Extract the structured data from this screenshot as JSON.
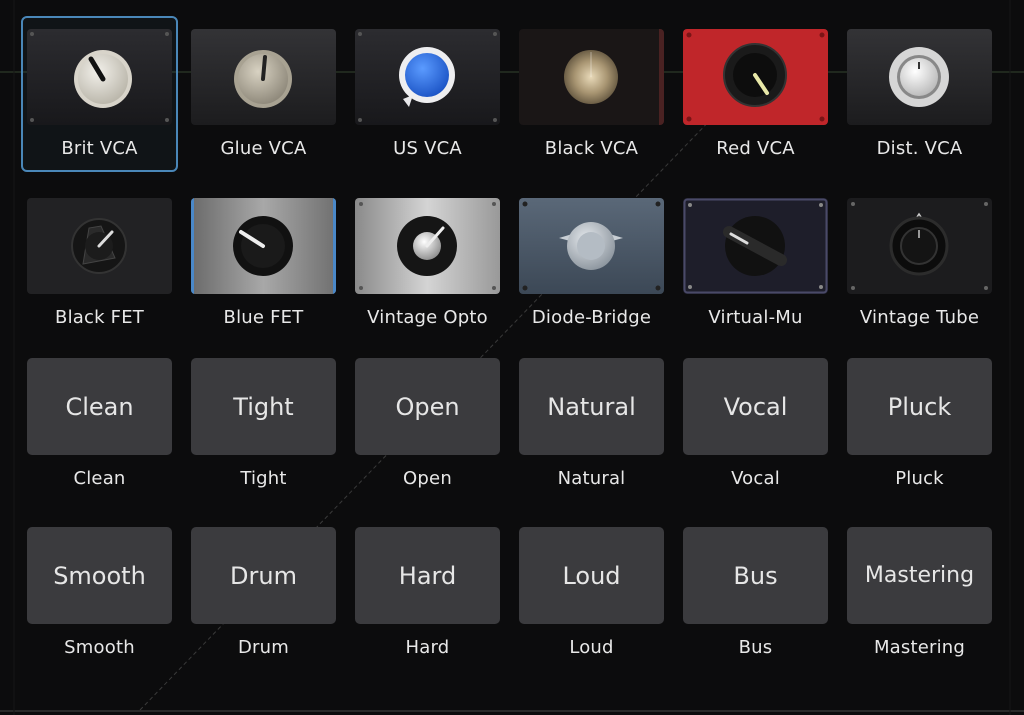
{
  "models": [
    {
      "label": "Brit VCA"
    },
    {
      "label": "Glue VCA"
    },
    {
      "label": "US VCA"
    },
    {
      "label": "Black VCA"
    },
    {
      "label": "Red VCA"
    },
    {
      "label": "Dist. VCA"
    },
    {
      "label": "Black FET"
    },
    {
      "label": "Blue FET"
    },
    {
      "label": "Vintage Opto"
    },
    {
      "label": "Diode-Bridge"
    },
    {
      "label": "Virtual-Mu"
    },
    {
      "label": "Vintage Tube"
    }
  ],
  "presets": [
    {
      "button": "Clean",
      "label": "Clean"
    },
    {
      "button": "Tight",
      "label": "Tight"
    },
    {
      "button": "Open",
      "label": "Open"
    },
    {
      "button": "Natural",
      "label": "Natural"
    },
    {
      "button": "Vocal",
      "label": "Vocal"
    },
    {
      "button": "Pluck",
      "label": "Pluck"
    },
    {
      "button": "Smooth",
      "label": "Smooth"
    },
    {
      "button": "Drum",
      "label": "Drum"
    },
    {
      "button": "Hard",
      "label": "Hard"
    },
    {
      "button": "Loud",
      "label": "Loud"
    },
    {
      "button": "Bus",
      "label": "Bus"
    },
    {
      "button": "Mastering",
      "label": "Mastering"
    }
  ],
  "colors": {
    "selection": "#4a87b8",
    "red_panel": "#c0262a",
    "blue_knob": "#2a6fe0",
    "preset_button": "#3b3b3e"
  }
}
